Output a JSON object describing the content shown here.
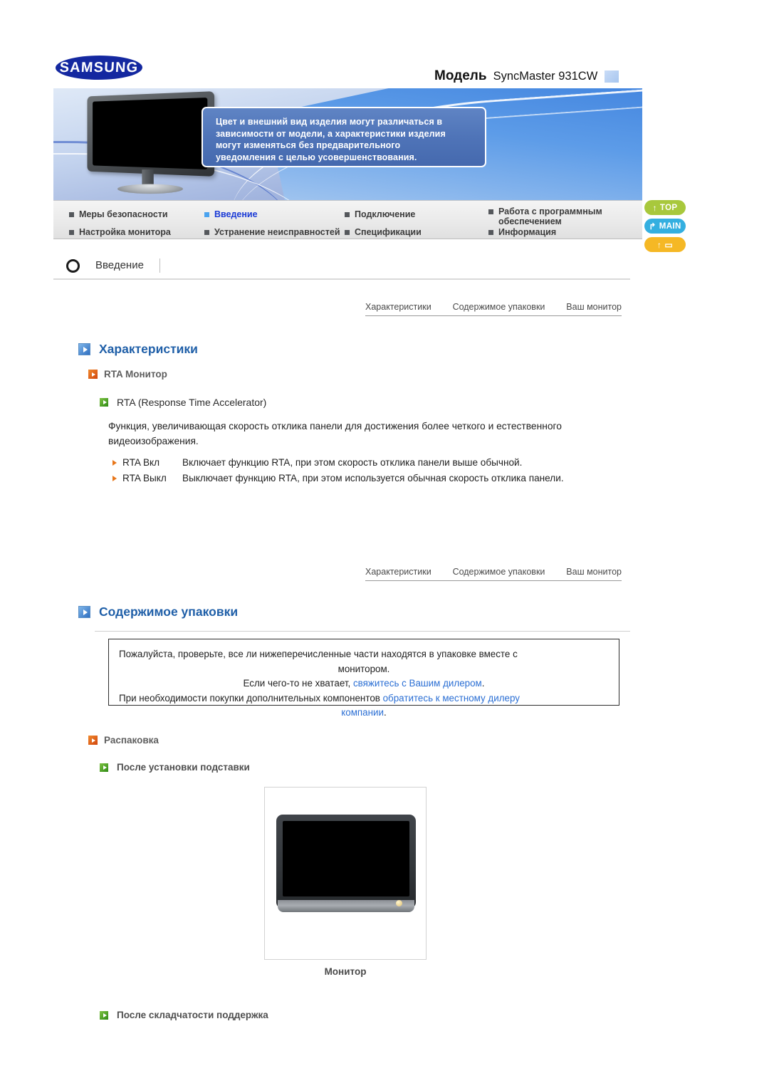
{
  "header": {
    "logo_text": "SAMSUNG",
    "model_label": "Модель",
    "model_value": "SyncMaster 931CW"
  },
  "banner": {
    "callout_line1": "Цвет и внешний вид изделия могут различаться в",
    "callout_line2": "зависимости от модели, а характеристики изделия",
    "callout_line3": "могут изменяться без предварительного",
    "callout_line4": "уведомления с целью усовершенствования."
  },
  "nav": {
    "items": [
      {
        "label": "Меры безопасности",
        "active": false
      },
      {
        "label": "Введение",
        "active": true
      },
      {
        "label": "Подключение",
        "active": false
      },
      {
        "label": "Работа с программным обеспечением",
        "active": false
      },
      {
        "label": "Настройка монитора",
        "active": false
      },
      {
        "label": "Устранение неисправностей",
        "active": false
      },
      {
        "label": "Спецификации",
        "active": false
      },
      {
        "label": "Информация",
        "active": false
      }
    ]
  },
  "side_buttons": [
    {
      "label": "TOP",
      "icon": "up-arrow-icon",
      "glyph": "↑",
      "color": "#a8c83c"
    },
    {
      "label": "MAIN",
      "icon": "branch-arrow-icon",
      "glyph": "↱",
      "color": "#34afe0"
    },
    {
      "label": "",
      "icon": "book-icon",
      "glyph": "↑",
      "glyph2": "▭",
      "color": "#f5b825"
    }
  ],
  "page": {
    "title": "Введение"
  },
  "breadcrumbs": [
    "Характеристики",
    "Содержимое упаковки",
    "Ваш монитор"
  ],
  "sections": {
    "features": {
      "heading": "Характеристики",
      "sub_heading": "RTA Монитор",
      "item_label": "RTA (Response Time Accelerator)",
      "paragraph": "Функция, увеличивающая скорость отклика панели для достижения более четкого и естественного видеоизображения.",
      "definitions": [
        {
          "term": "RTA Вкл",
          "desc": "Включает функцию RTA, при этом скорость отклика панели выше обычной."
        },
        {
          "term": "RTA Выкл",
          "desc": "Выключает функцию RTA, при этом используется обычная скорость отклика панели."
        }
      ]
    },
    "package": {
      "heading": "Содержимое упаковки",
      "notice": {
        "line1": "Пожалуйста, проверьте, все ли нижеперечисленные части находятся в упаковке вместе с",
        "line2": "монитором.",
        "line3_prefix": "Если чего-то не хватает, ",
        "line3_link": "свяжитесь с Вашим дилером",
        "line3_suffix": ".",
        "line4_prefix": "При необходимости покупки дополнительных компонентов ",
        "line4_link": "обратитесь к местному дилеру",
        "line5_link": "компании",
        "line5_suffix": "."
      },
      "sub_heading": "Распаковка",
      "stand_item": "После установки подставки",
      "figure_caption": "Монитор",
      "fold_item": "После складчатости поддержка"
    }
  },
  "colors": {
    "accent_blue": "#1f5fa8",
    "link_blue": "#2b6fd4",
    "orange": "#d1450d",
    "green": "#2f8a16",
    "nav_active": "#1a3ad6"
  }
}
